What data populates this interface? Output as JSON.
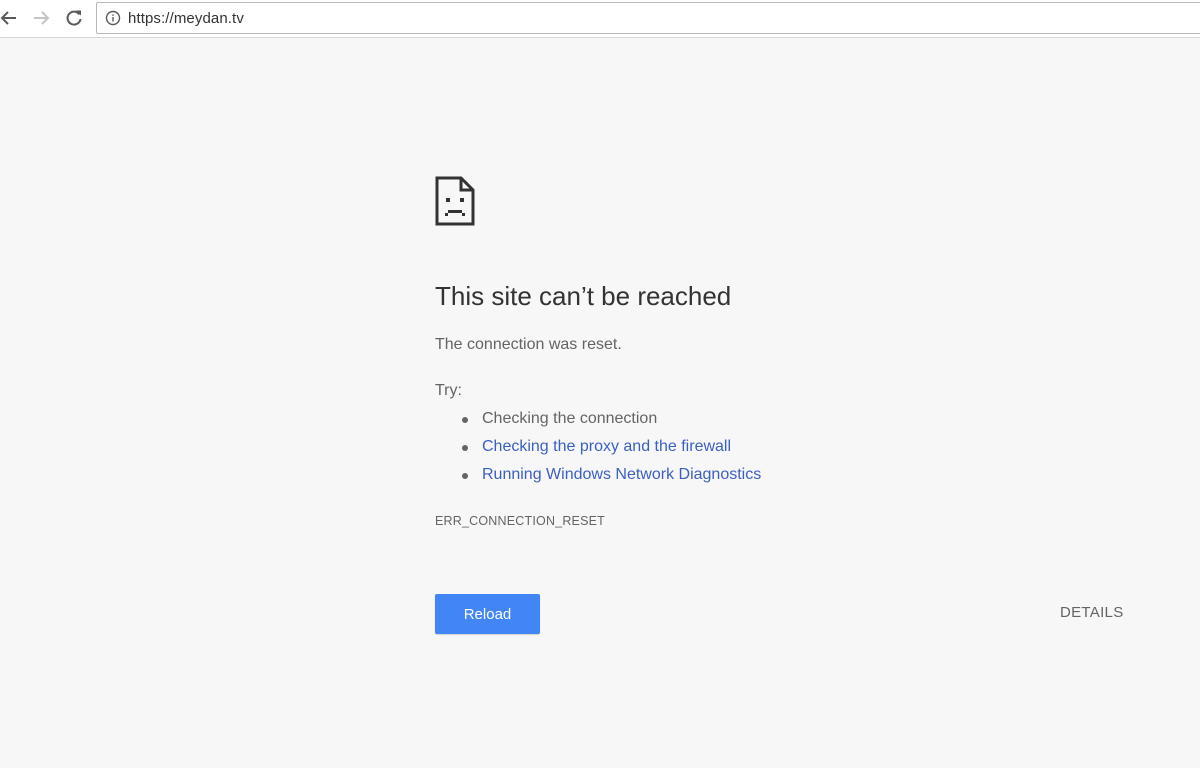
{
  "browser": {
    "url": "https://meydan.tv",
    "icons": {
      "back": "back-arrow-icon",
      "forward": "forward-arrow-icon",
      "reload": "reload-icon",
      "site_info": "info-icon"
    }
  },
  "error_page": {
    "icon": "sad-document-icon",
    "title": "This site can’t be reached",
    "subtitle": "The connection was reset.",
    "try_label": "Try:",
    "suggestions": [
      {
        "label": "Checking the connection",
        "is_link": false
      },
      {
        "label": "Checking the proxy and the firewall",
        "is_link": true
      },
      {
        "label": "Running Windows Network Diagnostics",
        "is_link": true
      }
    ],
    "error_code": "ERR_CONNECTION_RESET",
    "reload_label": "Reload",
    "details_label": "DETAILS"
  },
  "colors": {
    "background": "#f7f7f7",
    "link": "#3c5fc2",
    "button": "#4285f4",
    "text": "#646464",
    "title": "#333333"
  }
}
